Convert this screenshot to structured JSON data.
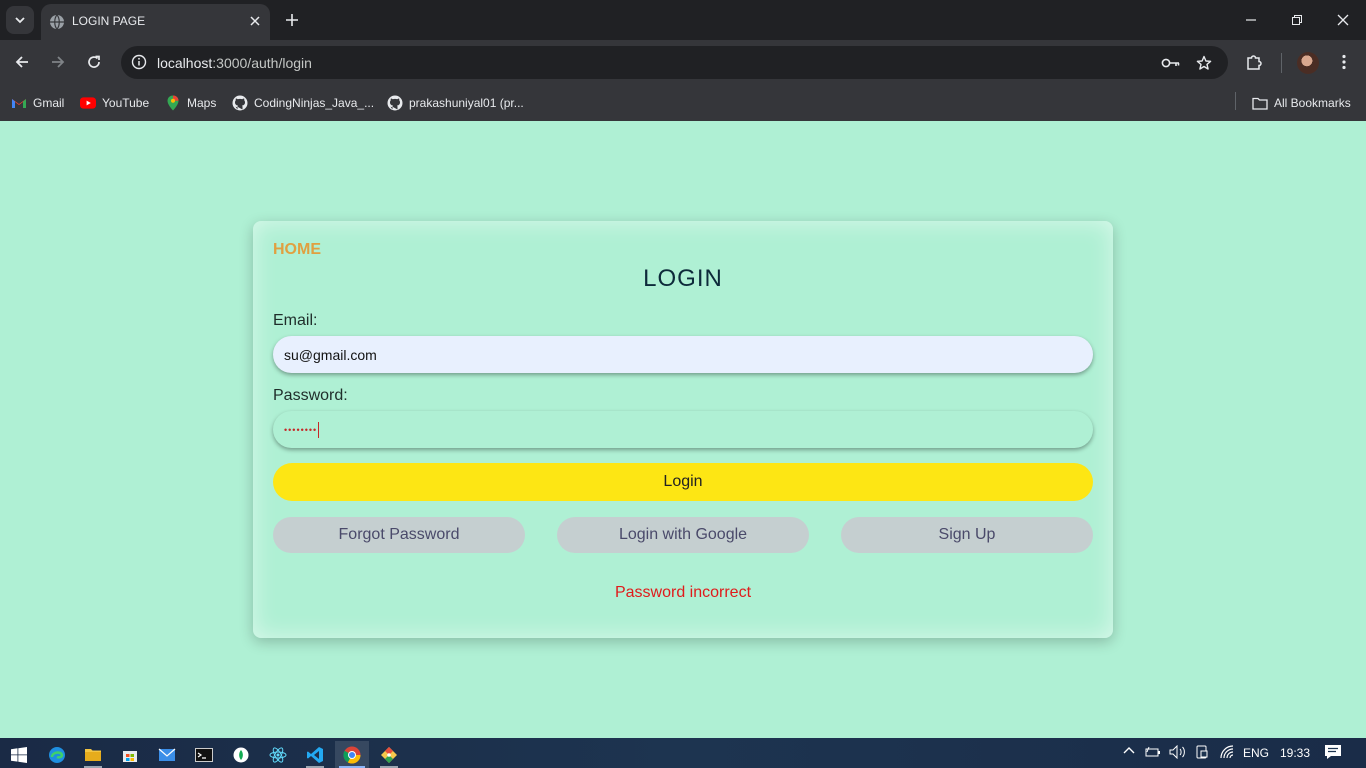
{
  "browser": {
    "tab_title": "LOGIN PAGE",
    "url_host": "localhost",
    "url_path": ":3000/auth/login",
    "bookmarks": [
      {
        "label": "Gmail",
        "icon": "gmail-icon"
      },
      {
        "label": "YouTube",
        "icon": "youtube-icon"
      },
      {
        "label": "Maps",
        "icon": "maps-icon"
      },
      {
        "label": "CodingNinjas_Java_...",
        "icon": "github-icon"
      },
      {
        "label": "prakashuniyal01 (pr...",
        "icon": "github-icon"
      }
    ],
    "all_bookmarks": "All Bookmarks"
  },
  "page": {
    "home_link": "HOME",
    "title": "LOGIN",
    "email_label": "Email:",
    "email_value": "su@gmail.com",
    "password_label": "Password:",
    "password_masked": "••••••••",
    "login_button": "Login",
    "forgot_button": "Forgot Password",
    "google_button": "Login with Google",
    "signup_button": "Sign Up",
    "error_message": "Password incorrect"
  },
  "taskbar": {
    "language": "ENG",
    "time": "19:33"
  },
  "colors": {
    "page_bg": "#aff0d4",
    "home_link": "#e0a040",
    "login_button": "#fde614",
    "alt_button": "#c5cfd0",
    "error": "#e01b1b"
  }
}
